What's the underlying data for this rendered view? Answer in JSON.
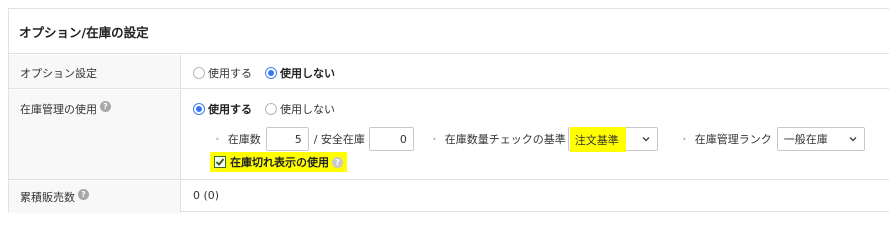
{
  "panel": {
    "title": "オプション/在庫の設定"
  },
  "option_setting": {
    "label": "オプション設定",
    "options": [
      {
        "label": "使用する",
        "checked": false
      },
      {
        "label": "使用しない",
        "checked": true
      }
    ]
  },
  "inventory": {
    "label": "在庫管理の使用",
    "help_icon": "?",
    "options": [
      {
        "label": "使用する",
        "checked": true
      },
      {
        "label": "使用しない",
        "checked": false
      }
    ],
    "stock_label": "在庫数",
    "stock_value": "5",
    "safety_label": "/ 安全在庫",
    "safety_value": "0",
    "check_basis_label": "在庫数量チェックの基準",
    "check_basis_value": "注文基準",
    "rank_label": "在庫管理ランク",
    "rank_value": "一般在庫",
    "out_of_stock_label": "在庫切れ表示の使用",
    "out_of_stock_checked": true,
    "bullet": "•"
  },
  "cumulative_sales": {
    "label": "累積販売数",
    "value": "0 (0)"
  },
  "colors": {
    "highlight": "#ffff00",
    "radio_accent": "#3478f6",
    "label_bg": "#f8f8f8",
    "border": "#e1e1e1"
  }
}
